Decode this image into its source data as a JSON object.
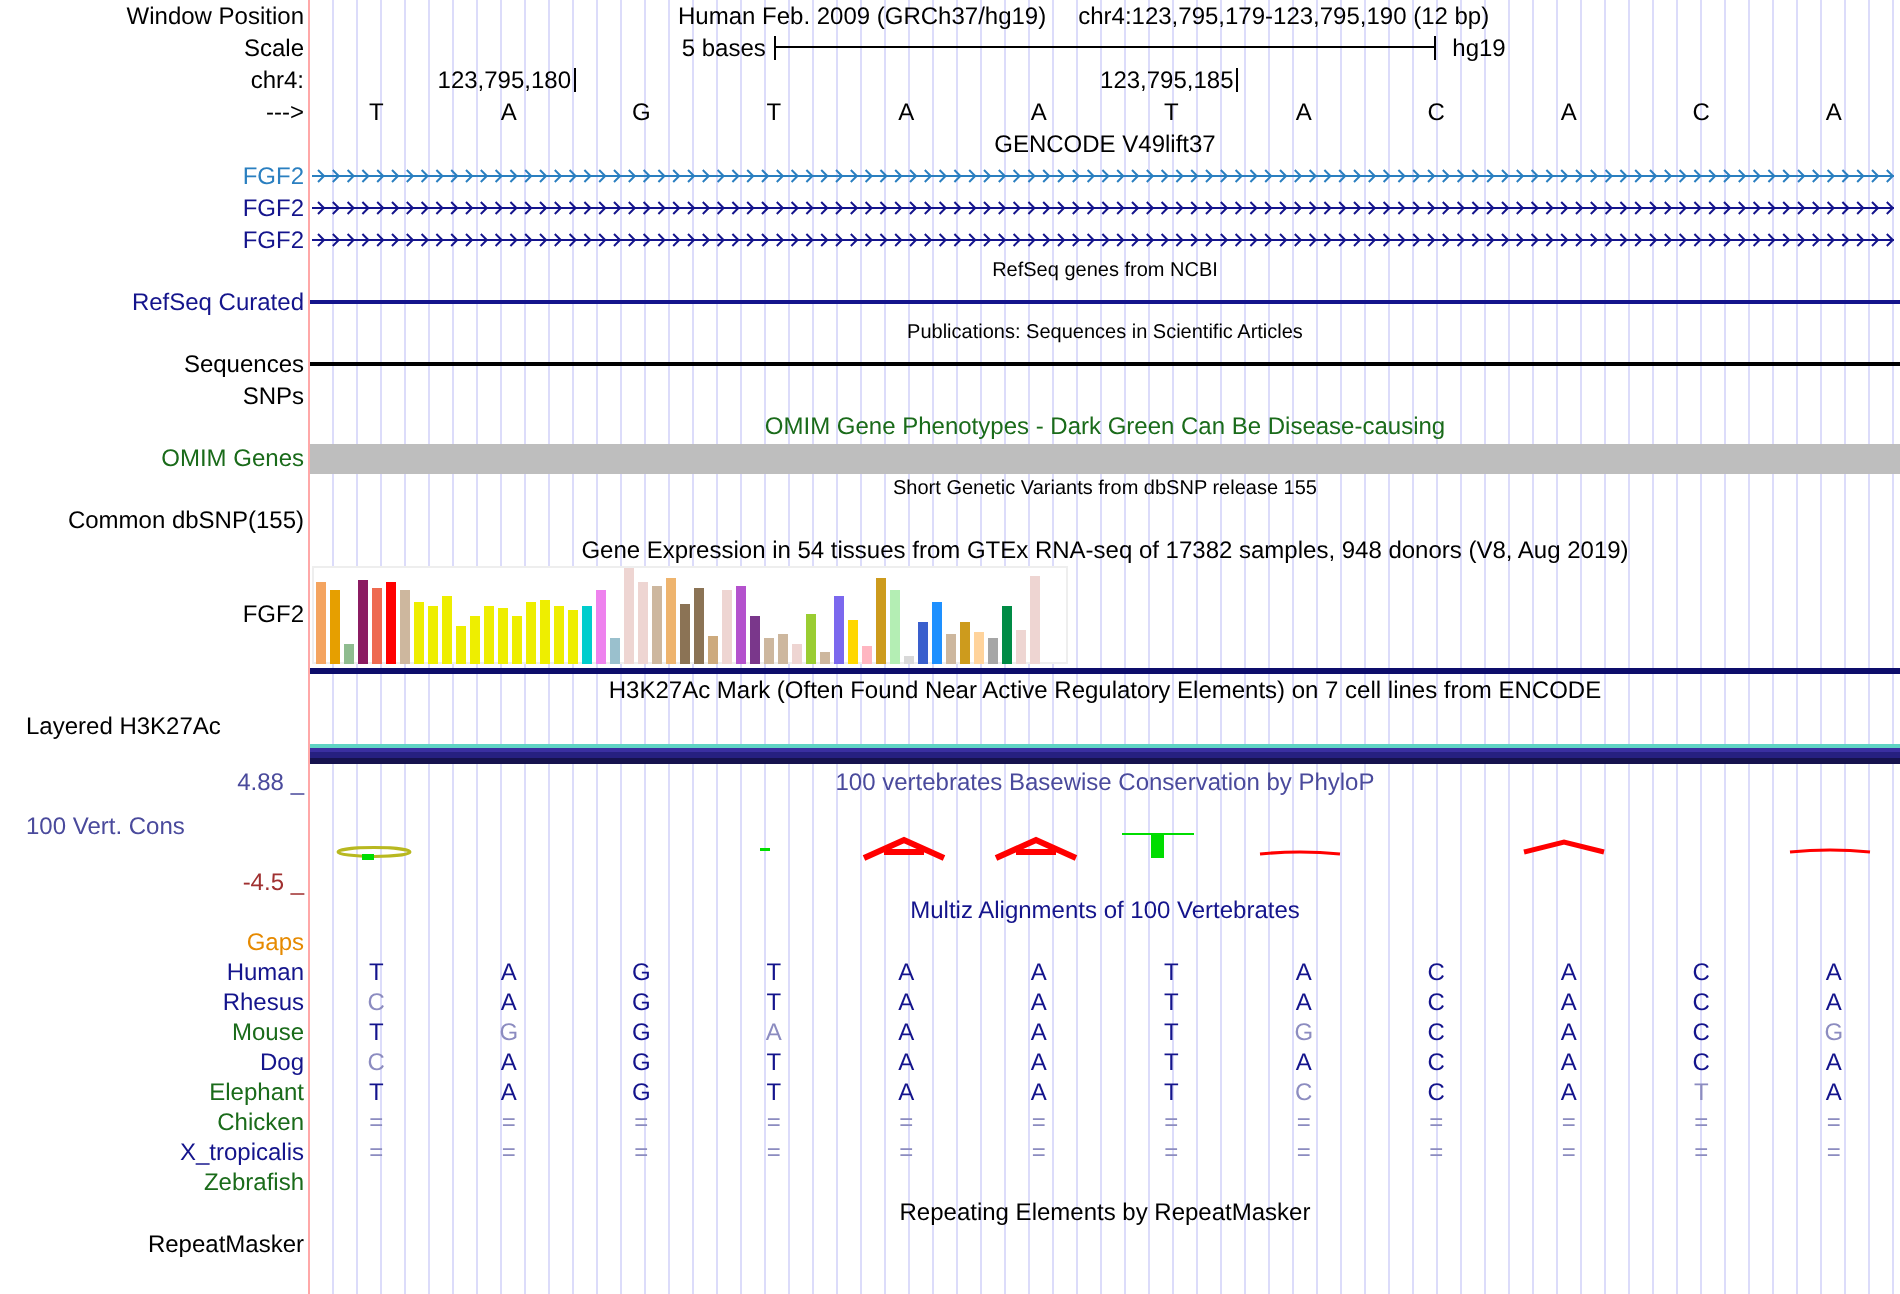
{
  "header": {
    "window_label": "Window Position",
    "title": "Human Feb. 2009 (GRCh37/hg19)",
    "range": "chr4:123,795,179-123,795,190 (12 bp)",
    "scale_label": "Scale",
    "scale_text": "5 bases",
    "assembly": "hg19",
    "chrom_label": "chr4:",
    "strand_label": "--->",
    "bases": [
      {
        "base": "T"
      },
      {
        "base": "A",
        "coordinate": "123,795,180"
      },
      {
        "base": "G"
      },
      {
        "base": "T"
      },
      {
        "base": "A"
      },
      {
        "base": "A"
      },
      {
        "base": "T",
        "coordinate": "123,795,185"
      },
      {
        "base": "A"
      },
      {
        "base": "C"
      },
      {
        "base": "A"
      },
      {
        "base": "C"
      },
      {
        "base": "A"
      }
    ]
  },
  "tracks": [
    {
      "title": "GENCODE V49lift37",
      "small_title": false,
      "rows": [
        {
          "label": "FGF2",
          "color": "#2a7fc0",
          "kind": "gene"
        },
        {
          "label": "FGF2",
          "color": "#14148c",
          "kind": "gene"
        },
        {
          "label": "FGF2",
          "color": "#14148c",
          "kind": "gene"
        }
      ]
    },
    {
      "title": "RefSeq genes from NCBI",
      "small_title": true,
      "rows": [
        {
          "label": "RefSeq Curated",
          "color": "#14148c",
          "kind": "line"
        }
      ]
    },
    {
      "title": "Publications: Sequences in Scientific Articles",
      "small_title": true,
      "rows": [
        {
          "label": "Sequences",
          "color": "#000000",
          "kind": "line"
        },
        {
          "label": "SNPs",
          "color": "#000000",
          "kind": "empty"
        }
      ]
    },
    {
      "title": "OMIM Gene Phenotypes - Dark Green Can Be Disease-causing",
      "small_title": false,
      "color": "#1a6b1a",
      "rows": [
        {
          "label": "OMIM Genes",
          "color": "#1a6b1a",
          "kind": "block"
        }
      ]
    },
    {
      "title": "Short Genetic Variants from dbSNP release 155",
      "small_title": true,
      "rows": [
        {
          "label": "Common dbSNP(155)",
          "color": "#000000",
          "kind": "empty"
        }
      ]
    },
    {
      "title": "Gene Expression in 54 tissues from GTEx RNA-seq of 17382 samples, 948 donors (V8, Aug 2019)",
      "small_title": false,
      "rows": [
        {
          "label": "FGF2",
          "color": "#000000",
          "kind": "expression"
        }
      ]
    },
    {
      "title": "H3K27Ac Mark (Often Found Near Active Regulatory Elements) on 7 cell lines from ENCODE",
      "small_title": false,
      "rows": [
        {
          "label": "Layered H3K27Ac",
          "color": "#000000",
          "kind": "layered"
        }
      ]
    },
    {
      "title": "100 vertebrates Basewise Conservation by PhyloP",
      "small_title": false,
      "color": "#4a4a9c",
      "max_label": "4.88 _",
      "rows": [
        {
          "label": "100 Vert. Cons",
          "color": "#4a4a9c",
          "kind": "wiggle",
          "min_label": "-4.5 _"
        }
      ]
    },
    {
      "title": "Multiz Alignments of 100 Vertebrates",
      "small_title": false,
      "color": "#14148c",
      "rows": [
        {
          "label": "Gaps",
          "color": "#e68a00",
          "kind": "empty"
        },
        {
          "label": "Human",
          "color": "#14148c",
          "kind": "alignment",
          "cells": [
            {
              "text": "T",
              "faded": false
            },
            {
              "text": "A",
              "faded": false
            },
            {
              "text": "G",
              "faded": false
            },
            {
              "text": "T",
              "faded": false
            },
            {
              "text": "A",
              "faded": false
            },
            {
              "text": "A",
              "faded": false
            },
            {
              "text": "T",
              "faded": false
            },
            {
              "text": "A",
              "faded": false
            },
            {
              "text": "C",
              "faded": false
            },
            {
              "text": "A",
              "faded": false
            },
            {
              "text": "C",
              "faded": false
            },
            {
              "text": "A",
              "faded": false
            }
          ]
        },
        {
          "label": "Rhesus",
          "color": "#14148c",
          "kind": "alignment",
          "cells": [
            {
              "text": "C",
              "faded": true
            },
            {
              "text": "A",
              "faded": false
            },
            {
              "text": "G",
              "faded": false
            },
            {
              "text": "T",
              "faded": false
            },
            {
              "text": "A",
              "faded": false
            },
            {
              "text": "A",
              "faded": false
            },
            {
              "text": "T",
              "faded": false
            },
            {
              "text": "A",
              "faded": false
            },
            {
              "text": "C",
              "faded": false
            },
            {
              "text": "A",
              "faded": false
            },
            {
              "text": "C",
              "faded": false
            },
            {
              "text": "A",
              "faded": false
            }
          ]
        },
        {
          "label": "Mouse",
          "color": "#1a6b1a",
          "kind": "alignment",
          "cells": [
            {
              "text": "T",
              "faded": false
            },
            {
              "text": "G",
              "faded": true
            },
            {
              "text": "G",
              "faded": false
            },
            {
              "text": "A",
              "faded": true
            },
            {
              "text": "A",
              "faded": false
            },
            {
              "text": "A",
              "faded": false
            },
            {
              "text": "T",
              "faded": false
            },
            {
              "text": "G",
              "faded": true
            },
            {
              "text": "C",
              "faded": false
            },
            {
              "text": "A",
              "faded": false
            },
            {
              "text": "C",
              "faded": false
            },
            {
              "text": "G",
              "faded": true
            }
          ]
        },
        {
          "label": "Dog",
          "color": "#14148c",
          "kind": "alignment",
          "cells": [
            {
              "text": "C",
              "faded": true
            },
            {
              "text": "A",
              "faded": false
            },
            {
              "text": "G",
              "faded": false
            },
            {
              "text": "T",
              "faded": false
            },
            {
              "text": "A",
              "faded": false
            },
            {
              "text": "A",
              "faded": false
            },
            {
              "text": "T",
              "faded": false
            },
            {
              "text": "A",
              "faded": false
            },
            {
              "text": "C",
              "faded": false
            },
            {
              "text": "A",
              "faded": false
            },
            {
              "text": "C",
              "faded": false
            },
            {
              "text": "A",
              "faded": false
            }
          ]
        },
        {
          "label": "Elephant",
          "color": "#1a6b1a",
          "kind": "alignment",
          "cells": [
            {
              "text": "T",
              "faded": false
            },
            {
              "text": "A",
              "faded": false
            },
            {
              "text": "G",
              "faded": false
            },
            {
              "text": "T",
              "faded": false
            },
            {
              "text": "A",
              "faded": false
            },
            {
              "text": "A",
              "faded": false
            },
            {
              "text": "T",
              "faded": false
            },
            {
              "text": "C",
              "faded": true
            },
            {
              "text": "C",
              "faded": false
            },
            {
              "text": "A",
              "faded": false
            },
            {
              "text": "T",
              "faded": true
            },
            {
              "text": "A",
              "faded": false
            }
          ]
        },
        {
          "label": "Chicken",
          "color": "#1a6b1a",
          "kind": "alignment",
          "cells": [
            {
              "text": "=",
              "faded": true
            },
            {
              "text": "=",
              "faded": true
            },
            {
              "text": "=",
              "faded": true
            },
            {
              "text": "=",
              "faded": true
            },
            {
              "text": "=",
              "faded": true
            },
            {
              "text": "=",
              "faded": true
            },
            {
              "text": "=",
              "faded": true
            },
            {
              "text": "=",
              "faded": true
            },
            {
              "text": "=",
              "faded": true
            },
            {
              "text": "=",
              "faded": true
            },
            {
              "text": "=",
              "faded": true
            },
            {
              "text": "=",
              "faded": true
            }
          ]
        },
        {
          "label": "X_tropicalis",
          "color": "#14148c",
          "kind": "alignment",
          "cells": [
            {
              "text": "=",
              "faded": true
            },
            {
              "text": "=",
              "faded": true
            },
            {
              "text": "=",
              "faded": true
            },
            {
              "text": "=",
              "faded": true
            },
            {
              "text": "=",
              "faded": true
            },
            {
              "text": "=",
              "faded": true
            },
            {
              "text": "=",
              "faded": true
            },
            {
              "text": "=",
              "faded": true
            },
            {
              "text": "=",
              "faded": true
            },
            {
              "text": "=",
              "faded": true
            },
            {
              "text": "=",
              "faded": true
            },
            {
              "text": "=",
              "faded": true
            }
          ]
        },
        {
          "label": "Zebrafish",
          "color": "#1a6b1a",
          "kind": "empty"
        }
      ]
    },
    {
      "title": "Repeating Elements by RepeatMasker",
      "small_title": false,
      "rows": [
        {
          "label": "RepeatMasker",
          "color": "#000000",
          "kind": "empty"
        }
      ]
    }
  ]
}
